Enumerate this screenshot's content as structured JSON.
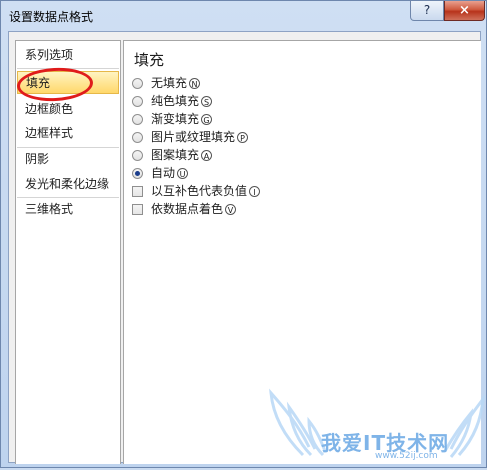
{
  "window": {
    "title": "设置数据点格式",
    "help_label": "?",
    "close_label": "×"
  },
  "sidebar": {
    "items": [
      {
        "label": "系列选项"
      },
      {
        "label": "填充"
      },
      {
        "label": "边框颜色"
      },
      {
        "label": "边框样式"
      },
      {
        "label": "阴影"
      },
      {
        "label": "发光和柔化边缘"
      },
      {
        "label": "三维格式"
      }
    ],
    "selected": "填充"
  },
  "panel": {
    "title": "填充",
    "radio_options": [
      {
        "label": "无填充",
        "key": "N",
        "checked": false
      },
      {
        "label": "纯色填充",
        "key": "S",
        "checked": false
      },
      {
        "label": "渐变填充",
        "key": "G",
        "checked": false
      },
      {
        "label": "图片或纹理填充",
        "key": "P",
        "checked": false
      },
      {
        "label": "图案填充",
        "key": "A",
        "checked": false
      },
      {
        "label": "自动",
        "key": "U",
        "checked": true
      }
    ],
    "checkbox_options": [
      {
        "label": "以互补色代表负值",
        "key": "I",
        "checked": false
      },
      {
        "label": "依数据点着色",
        "key": "V",
        "checked": false
      }
    ]
  },
  "watermark": {
    "text": "我爱IT技术网",
    "url": "www.52ij.com"
  },
  "colors": {
    "highlight": "#ffd86b",
    "annotation": "#e01b1b"
  }
}
